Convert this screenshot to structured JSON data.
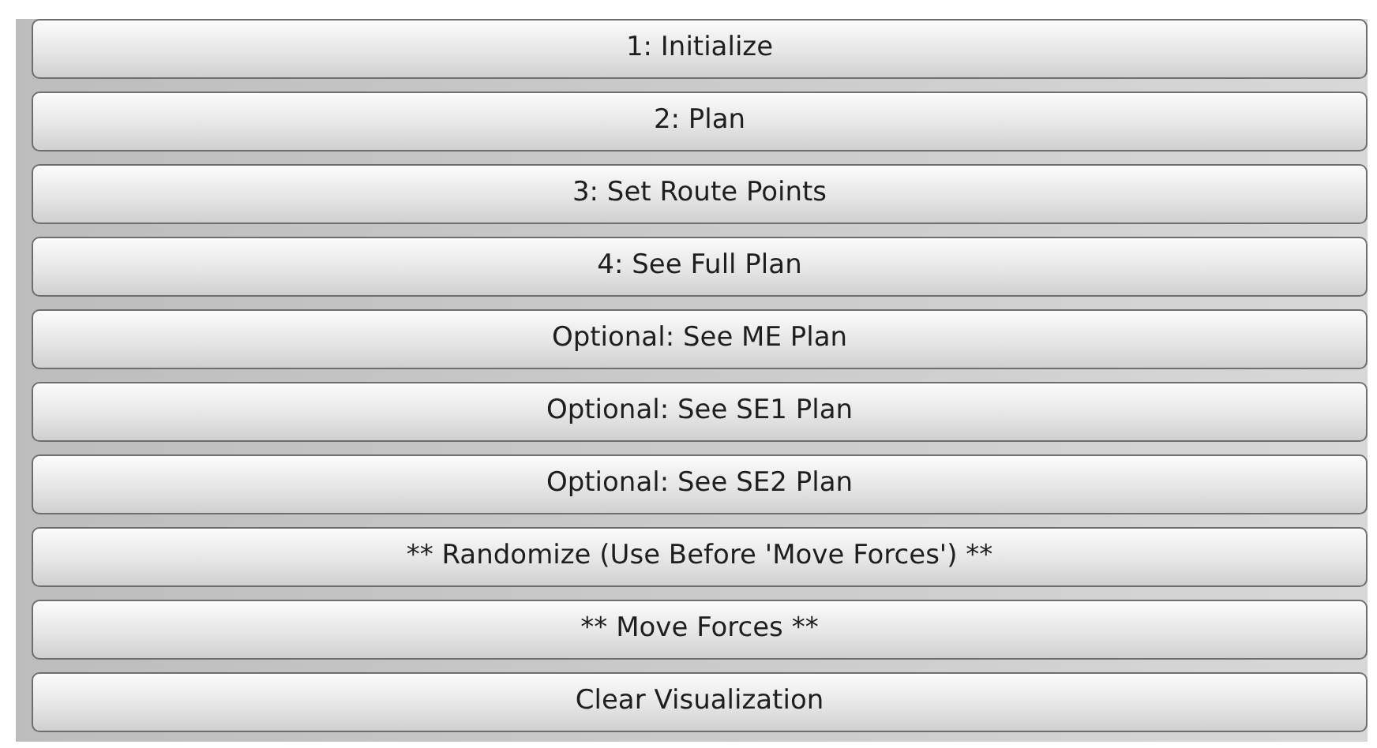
{
  "buttons": [
    {
      "label": "1: Initialize"
    },
    {
      "label": "2: Plan"
    },
    {
      "label": "3: Set Route Points"
    },
    {
      "label": "4: See Full Plan"
    },
    {
      "label": "Optional: See ME Plan"
    },
    {
      "label": "Optional: See SE1 Plan"
    },
    {
      "label": "Optional: See SE2 Plan"
    },
    {
      "label": "** Randomize (Use Before 'Move Forces') **"
    },
    {
      "label": "** Move Forces **"
    },
    {
      "label": "Clear Visualization"
    }
  ]
}
